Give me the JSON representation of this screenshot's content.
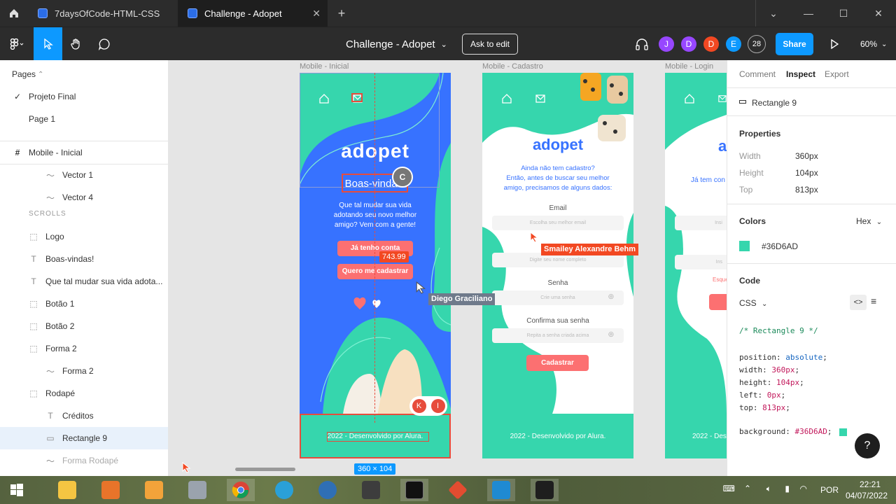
{
  "browser": {
    "tabs": [
      {
        "label": "7daysOfCode-HTML-CSS"
      },
      {
        "label": "Challenge - Adopet"
      }
    ]
  },
  "toolbar": {
    "doc_title": "Challenge - Adopet",
    "ask_label": "Ask to edit",
    "avatars": [
      "J",
      "D",
      "D",
      "E",
      "28"
    ],
    "avatar_colors": [
      "#9747ff",
      "#9747ff",
      "#f24822",
      "#0d99ff",
      "#2c2c2c"
    ],
    "share_label": "Share",
    "zoom": "60%"
  },
  "left": {
    "pages_title": "Pages",
    "pages": [
      "Projeto Final",
      "Page 1"
    ],
    "frame": "Mobile - Inicial",
    "section": "SCROLLS",
    "layers": [
      {
        "label": "Vector 1",
        "icon": "vector-icon"
      },
      {
        "label": "Vector 4",
        "icon": "vector-icon"
      },
      {
        "label": "Logo",
        "icon": "frame-icon"
      },
      {
        "label": "Boas-vindas!",
        "icon": "text-icon"
      },
      {
        "label": "Que tal mudar sua vida adota...",
        "icon": "text-icon"
      },
      {
        "label": "Botão 1",
        "icon": "frame-icon"
      },
      {
        "label": "Botão 2",
        "icon": "frame-icon"
      },
      {
        "label": "Forma 2",
        "icon": "frame-icon"
      },
      {
        "label": "Forma 2",
        "icon": "vector-icon"
      },
      {
        "label": "Rodapé",
        "icon": "frame-icon"
      },
      {
        "label": "Créditos",
        "icon": "text-icon"
      },
      {
        "label": "Rectangle 9",
        "icon": "rectangle-icon"
      },
      {
        "label": "Forma Rodapé",
        "icon": "vector-icon"
      }
    ]
  },
  "canvas": {
    "frames": [
      "Mobile - Inicial",
      "Mobile - Cadastro",
      "Mobile - Login"
    ],
    "inicial": {
      "logo": "adopet",
      "welcome": "Boas-vindas!",
      "intro_1": "Que tal mudar sua vida",
      "intro_2": "adotando seu novo melhor",
      "intro_3": "amigo? Vem com a gente!",
      "btn1": "Já tenho conta",
      "btn2": "Quero me cadastrar",
      "footer": "2022 - Desenvolvido por Alura.",
      "measure": "743.99",
      "size_badge": "360 × 104",
      "comment_initial": "C",
      "pin_initials": [
        "K",
        "I"
      ]
    },
    "cadastro": {
      "logo": "adopet",
      "q1": "Ainda não tem cadastro?",
      "q2": "Então, antes de buscar seu melhor",
      "q3": "amigo, precisamos de alguns dados:",
      "email_label": "Email",
      "email_ph": "Escolha seu melhor email",
      "name_ph": "Digite seu nome completo",
      "senha_label": "Senha",
      "senha_ph": "Crie uma senha",
      "confirm_label": "Confirma sua senha",
      "confirm_ph": "Repita a senha criada acima",
      "submit": "Cadastrar",
      "footer": "2022 - Desenvolvido por Alura."
    },
    "login": {
      "logo": "ado",
      "text": "Já tem con",
      "input_ph": "Insi",
      "input2_ph": "Ins",
      "error": "Esque",
      "footer": "2022 - Des"
    },
    "cursors": [
      "Smailey Alexandre Behm",
      "Diego Graciliano"
    ],
    "cursor_colors": [
      "#f24822",
      "#6f7a8b"
    ]
  },
  "right": {
    "tabs": [
      "Comment",
      "Inspect",
      "Export"
    ],
    "layer": "Rectangle 9",
    "properties_title": "Properties",
    "props": [
      {
        "k": "Width",
        "v": "360px"
      },
      {
        "k": "Height",
        "v": "104px"
      },
      {
        "k": "Top",
        "v": "813px"
      }
    ],
    "colors_title": "Colors",
    "color_format": "Hex",
    "color_hex": "#36D6AD",
    "code_title": "Code",
    "code_lang": "CSS",
    "code_comment": "/* Rectangle 9 */",
    "code_lines": [
      {
        "p": "position",
        "v": "absolute"
      },
      {
        "p": "width",
        "v": "360px"
      },
      {
        "p": "height",
        "v": "104px"
      },
      {
        "p": "left",
        "v": "0px"
      },
      {
        "p": "top",
        "v": "813px"
      }
    ],
    "code_bg": {
      "p": "background",
      "v": "#36D6AD"
    },
    "help": "?"
  },
  "tray": {
    "lang": "POR",
    "time": "22:21",
    "date": "04/07/2022"
  },
  "colors": {
    "teal": "#36D6AD",
    "blue": "#3772FF",
    "coral": "#FC7071",
    "figma_blue": "#0d99ff"
  }
}
